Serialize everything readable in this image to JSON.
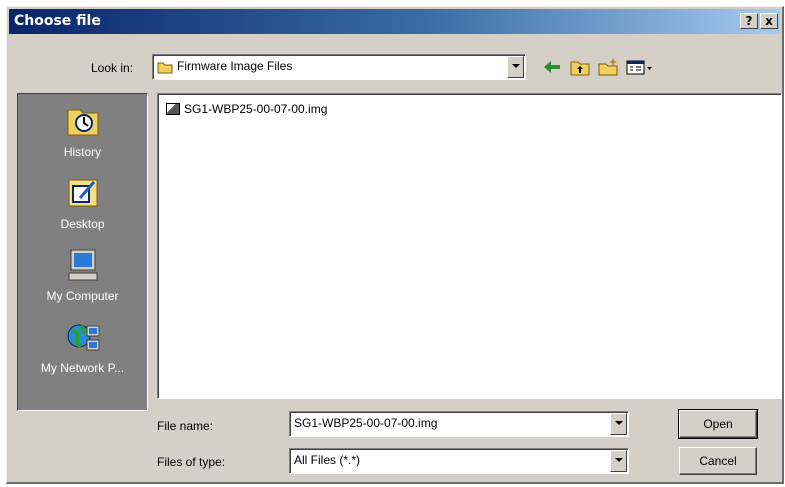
{
  "window": {
    "title": "Choose file",
    "help_label": "?",
    "close_label": "x"
  },
  "toolbar": {
    "look_in_label": "Look in:",
    "look_in_value": "Firmware Image Files",
    "icons": [
      "back-icon",
      "up-folder-icon",
      "new-folder-icon",
      "view-menu-icon"
    ]
  },
  "places": [
    {
      "label": "History",
      "icon": "history-icon"
    },
    {
      "label": "Desktop",
      "icon": "desktop-icon"
    },
    {
      "label": "My Computer",
      "icon": "my-computer-icon"
    },
    {
      "label": "My Network P...",
      "icon": "my-network-places-icon"
    }
  ],
  "files": [
    {
      "name": "SG1-WBP25-00-07-00.img",
      "icon": "image-file-icon"
    }
  ],
  "form": {
    "file_name_label": "File name:",
    "file_name_value": "SG1-WBP25-00-07-00.img",
    "file_type_label": "Files of type:",
    "file_type_value": "All Files (*.*)"
  },
  "buttons": {
    "open": "Open",
    "cancel": "Cancel"
  },
  "colors": {
    "titlebar_start": "#0a246a",
    "titlebar_end": "#a6caf0",
    "dialog_bg": "#d4d0c8",
    "places_bg": "#808080"
  }
}
